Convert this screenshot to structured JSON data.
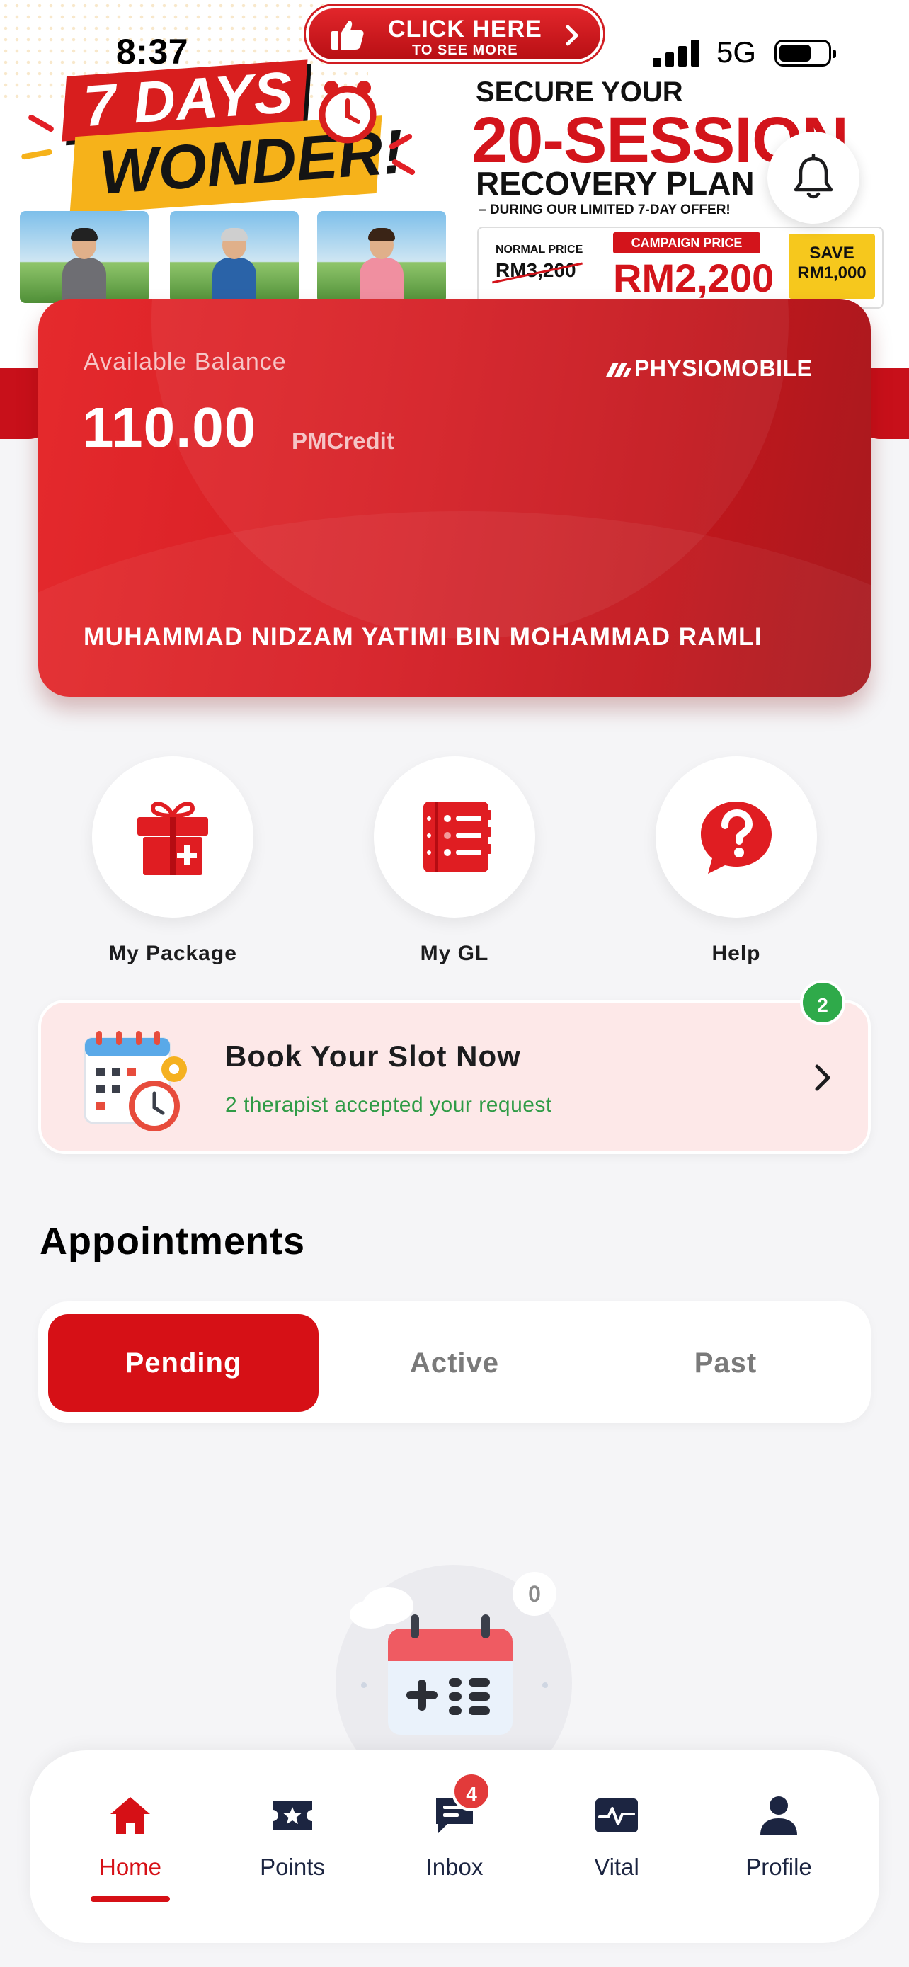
{
  "status_bar": {
    "time": "8:37",
    "network": "5G"
  },
  "promo": {
    "cta_main": "CLICK HERE",
    "cta_sub": "TO SEE MORE",
    "days_line": "7 DAYS",
    "wonder_line": "WONDER!",
    "secure_line": "SECURE YOUR",
    "sessions_line": "20-SESSION",
    "plan_line": "RECOVERY PLAN",
    "during_line": "– DURING OUR LIMITED 7-DAY OFFER!",
    "normal_price_label": "NORMAL PRICE",
    "normal_price": "RM3,200",
    "campaign_price_label": "CAMPAIGN PRICE",
    "campaign_price": "RM2,200",
    "save_label": "SAVE",
    "save_amount": "RM1,000"
  },
  "balance_card": {
    "label": "Available Balance",
    "amount": "110.00",
    "unit": "PMCredit",
    "brand": "PHYSIOMOBILE",
    "holder_name": "MUHAMMAD NIDZAM YATIMI BIN MOHAMMAD RAMLI"
  },
  "quick_actions": [
    {
      "label": "My Package",
      "icon": "gift-icon"
    },
    {
      "label": "My GL",
      "icon": "list-book-icon"
    },
    {
      "label": "Help",
      "icon": "help-bubble-icon"
    }
  ],
  "book_slot": {
    "title": "Book Your Slot Now",
    "subtitle": "2 therapist accepted your request",
    "badge_count": "2"
  },
  "appointments": {
    "title": "Appointments",
    "tabs": [
      "Pending",
      "Active",
      "Past"
    ],
    "active_tab": "Pending",
    "empty_count": "0"
  },
  "tab_bar": {
    "items": [
      {
        "label": "Home",
        "icon": "home-icon"
      },
      {
        "label": "Points",
        "icon": "ticket-star-icon"
      },
      {
        "label": "Inbox",
        "icon": "chat-icon",
        "badge": "4"
      },
      {
        "label": "Vital",
        "icon": "pulse-icon"
      },
      {
        "label": "Profile",
        "icon": "person-icon"
      }
    ],
    "active": "Home"
  },
  "colors": {
    "brand_red": "#d61016",
    "success_green": "#2faa4a",
    "nav_dark": "#1c2541"
  }
}
